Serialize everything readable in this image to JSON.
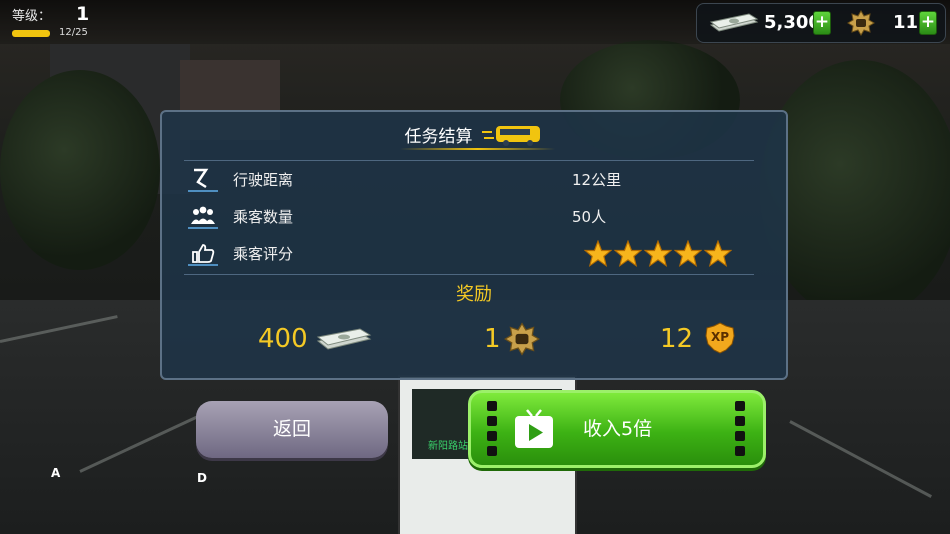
{
  "topbar": {
    "level_label": "等级：",
    "level": "1",
    "xp_progress": "12/25",
    "xp_fraction": 0.48,
    "cash": "5,300",
    "badges": "11",
    "plus": "+"
  },
  "panel": {
    "title": "任务结算",
    "rows": [
      {
        "label": "行驶距离",
        "value": "12公里",
        "icon": "route-icon"
      },
      {
        "label": "乘客数量",
        "value": "50人",
        "icon": "passengers-icon"
      },
      {
        "label": "乘客评分",
        "value": "",
        "icon": "thumbs-up-icon"
      }
    ],
    "rating_stars": 5,
    "reward_title": "奖励",
    "rewards": {
      "cash": "400",
      "badge": "1",
      "xp": "12",
      "xp_label": "XP"
    }
  },
  "buttons": {
    "back": "返回",
    "five_times": "收入5倍"
  },
  "markers": {
    "a": "A",
    "d": "D"
  },
  "bus_sign": "新阳路站",
  "colors": {
    "accent": "#f4c925",
    "panel": "#1e3448",
    "green": "#3db214"
  }
}
